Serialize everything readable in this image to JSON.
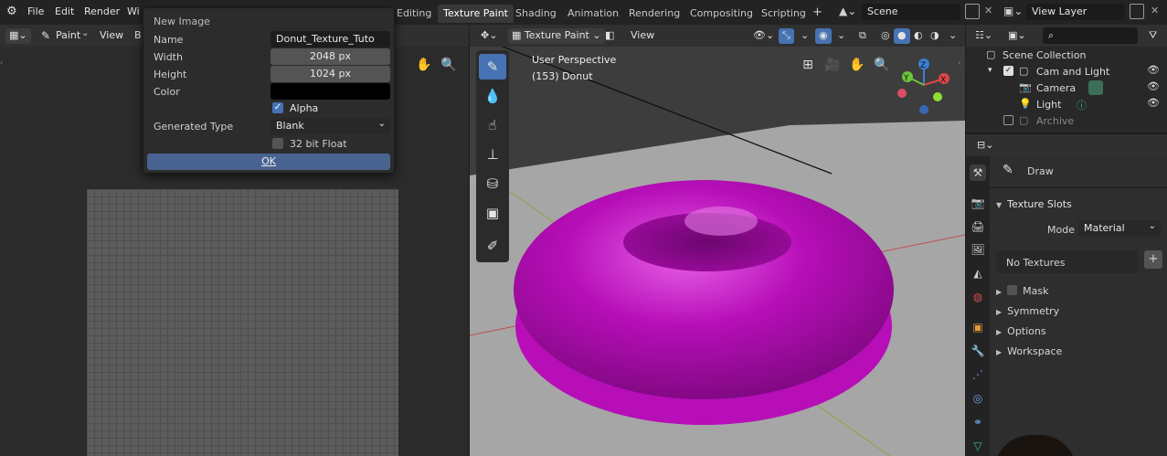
{
  "topbar": {
    "menu": [
      "File",
      "Edit",
      "Render",
      "Wi"
    ],
    "workspaces": [
      {
        "label": "Editing",
        "active": false
      },
      {
        "label": "Texture Paint",
        "active": true
      },
      {
        "label": "Shading",
        "active": false
      },
      {
        "label": "Animation",
        "active": false
      },
      {
        "label": "Rendering",
        "active": false
      },
      {
        "label": "Compositing",
        "active": false
      },
      {
        "label": "Scripting",
        "active": false
      }
    ],
    "add_tab": "+",
    "scene_label": "Scene",
    "view_layer_label": "View Layer"
  },
  "image_editor": {
    "mode_label": "Paint",
    "view_label": "View",
    "extra_label": "B"
  },
  "new_image_dialog": {
    "title": "New Image",
    "name_label": "Name",
    "name_value": "Donut_Texture_Tuto",
    "width_label": "Width",
    "width_value": "2048 px",
    "height_label": "Height",
    "height_value": "1024 px",
    "color_label": "Color",
    "color_value": "#000000",
    "alpha_label": "Alpha",
    "alpha_checked": true,
    "generated_type_label": "Generated Type",
    "generated_type_value": "Blank",
    "float_label": "32 bit Float",
    "float_checked": false,
    "ok_label": "OK"
  },
  "viewport": {
    "mode_label": "Texture Paint",
    "view_label": "View",
    "perspective_label": "User Perspective",
    "object_label": "(153) Donut",
    "donut_color": "#b70eb8",
    "gizmo_labels": {
      "x": "X",
      "y": "Y",
      "z": "Z"
    }
  },
  "outliner": {
    "root_label": "Scene Collection",
    "items": [
      {
        "label": "Cam and Light",
        "type": "collection"
      },
      {
        "label": "Camera",
        "type": "camera"
      },
      {
        "label": "Light",
        "type": "light"
      },
      {
        "label": "Archive",
        "type": "collection"
      }
    ]
  },
  "properties": {
    "tool_label": "Draw",
    "texture_slots_label": "Texture Slots",
    "mode_label": "Mode",
    "mode_value": "Material",
    "no_textures_label": "No Textures",
    "panels": [
      "Mask",
      "Symmetry",
      "Options",
      "Workspace"
    ]
  }
}
